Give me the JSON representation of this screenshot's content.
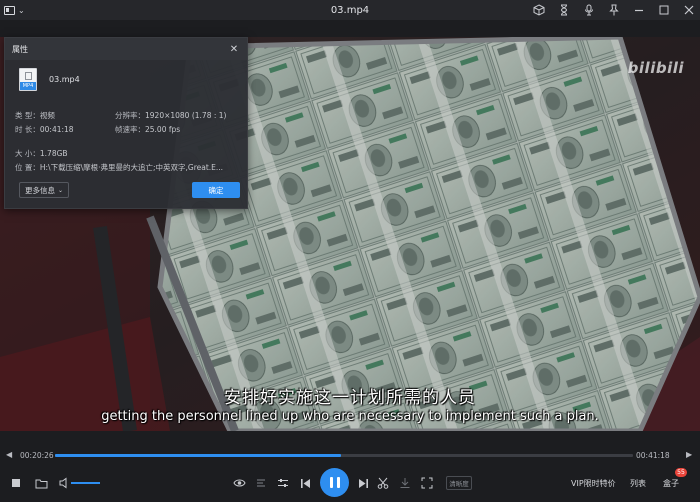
{
  "window": {
    "title": "03.mp4"
  },
  "titlebar_icons": [
    "cube-icon",
    "hourglass-icon",
    "microphone-icon",
    "pin-icon",
    "minimize-icon",
    "maximize-icon",
    "close-icon"
  ],
  "video": {
    "watermark": "bilibili",
    "subtitle_cn": "安排好实施这一计划所需的人员",
    "subtitle_en": "getting the personnel lined up who are necessary to implement such a plan."
  },
  "properties": {
    "title": "属性",
    "file_name": "03.mp4",
    "file_tag": "MP4",
    "type_label": "类 型：",
    "type_value": "视频",
    "duration_label": "时 长：",
    "duration_value": "00:41:18",
    "resolution_label": "分辨率：",
    "resolution_value": "1920×1080 (1.78 : 1)",
    "framerate_label": "帧速率：",
    "framerate_value": "25.00 fps",
    "size_label": "大 小：",
    "size_value": "1.78GB",
    "location_label": "位 置：",
    "location_value": "H:\\下载压缩\\摩根·弗里曼的大追亡;中英双字,Great.E...",
    "more_label": "更多信息",
    "ok_label": "确定"
  },
  "progress": {
    "current": "00:20:26",
    "total": "00:41:18",
    "fraction": 0.495
  },
  "controls": {
    "clarity_label": "清晰度",
    "vip_label": "VIP限时特价",
    "list_label": "列表",
    "box_label": "盒子",
    "box_badge": "55",
    "volume_fraction": 0.7
  },
  "colors": {
    "accent": "#2e8ef0",
    "badge": "#e9443a"
  }
}
